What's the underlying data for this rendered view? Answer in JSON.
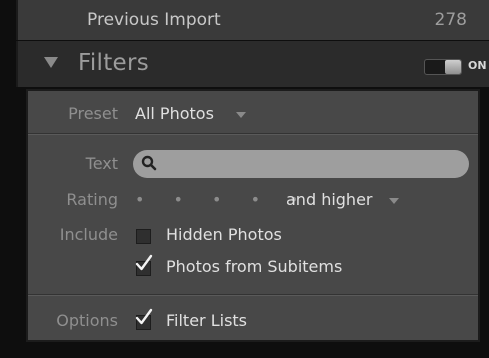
{
  "previous_import": {
    "label": "Previous Import",
    "count": "278"
  },
  "filters": {
    "title": "Filters",
    "toggle_label": "ON",
    "toggle_state": "on"
  },
  "preset": {
    "label": "Preset",
    "value": "All Photos"
  },
  "text_filter": {
    "label": "Text",
    "value": ""
  },
  "rating": {
    "label": "Rating",
    "dots": "• • • • •",
    "comparison": "and higher"
  },
  "include": {
    "label": "Include",
    "options": [
      {
        "label": "Hidden Photos",
        "checked": false
      },
      {
        "label": "Photos from Subitems",
        "checked": true
      }
    ]
  },
  "options": {
    "label": "Options",
    "filter_lists_label": "Filter Lists",
    "filter_lists_checked": true
  },
  "icons": {
    "disclosure": "triangle-down-icon",
    "search": "magnifier-icon",
    "check": "checkmark-icon"
  }
}
